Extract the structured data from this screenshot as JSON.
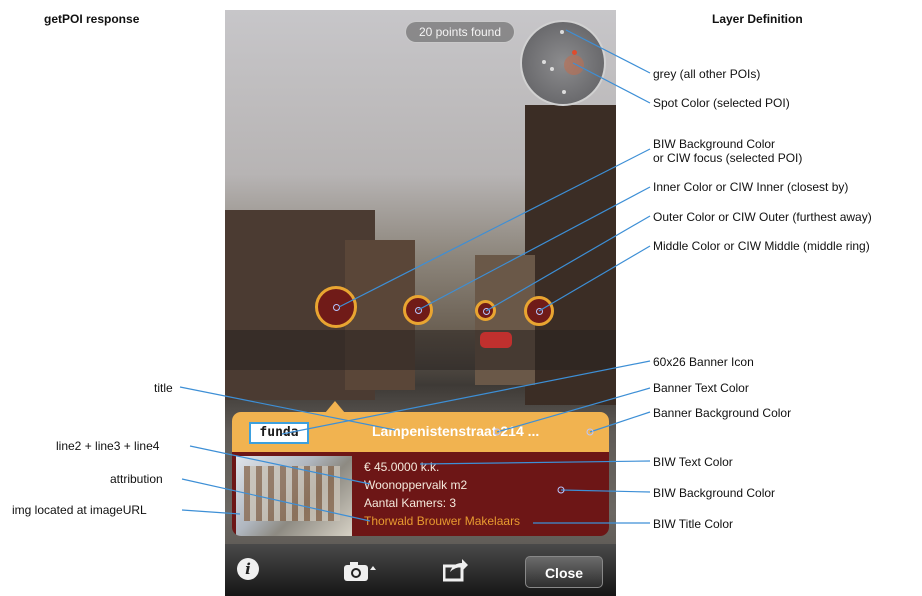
{
  "headings": {
    "left": "getPOI response",
    "right": "Layer Definition"
  },
  "phone": {
    "points_found": "20 points found",
    "banner_icon_text": "funda",
    "banner_title": "Lampenistenstraat 214 ...",
    "biw_lines": [
      "€ 45.0000 k.k.",
      "Woonoppervalk m2",
      "Aantal Kamers: 3"
    ],
    "attribution": "Thorwald Brouwer Makelaars",
    "toolbar": {
      "info_icon": "info-icon",
      "camera_icon": "camera-icon",
      "share_icon": "share-icon",
      "close_label": "Close"
    }
  },
  "right_labels": [
    "grey (all other POIs)",
    "Spot Color (selected POI)",
    "BIW Background Color\nor CIW focus (selected POI)",
    "Inner Color or CIW Inner (closest by)",
    "Outer Color or CIW Outer (furthest away)",
    "Middle Color or CIW Middle (middle ring)",
    "60x26 Banner Icon",
    "Banner Text Color",
    "Banner Background Color",
    "BIW Text Color",
    "BIW Background Color",
    "BIW Title Color"
  ],
  "left_labels": [
    "title",
    "line2 + line3 + line4",
    "attribution",
    "img located at imageURL"
  ],
  "colors": {
    "banner": "#f1b350",
    "biw_background": "#6d1616",
    "poi_ring": "#e9a531",
    "leader_line": "#3d8fd6",
    "attribution": "#e79a30"
  }
}
